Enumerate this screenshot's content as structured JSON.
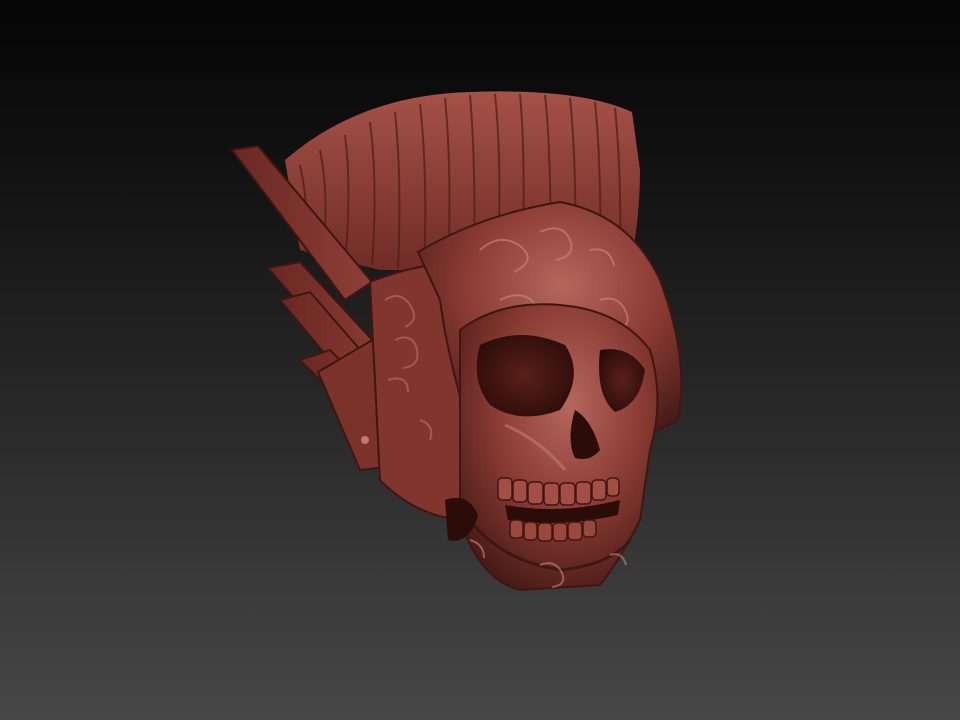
{
  "scene": {
    "subject": "",
    "colors": {
      "clay_base": "#8a3b33",
      "clay_shadow": "#3e1612",
      "clay_light": "#b5675c",
      "background_top": "#050505",
      "background_bottom": "#474747"
    }
  }
}
